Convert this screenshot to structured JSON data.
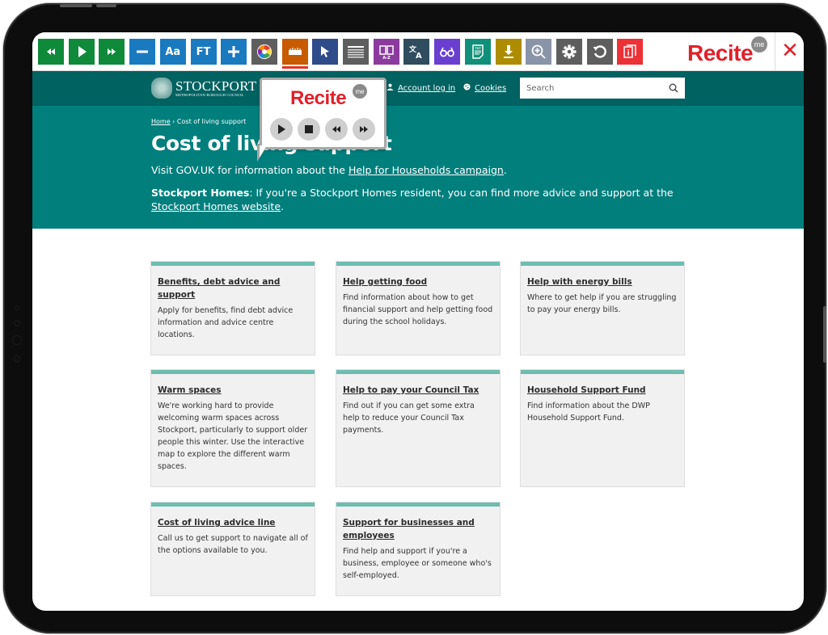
{
  "recite_toolbar": {
    "buttons": [
      {
        "name": "rewind-button",
        "icon": "rewind-icon",
        "label": "",
        "color": "#0f8a3b"
      },
      {
        "name": "play-button",
        "icon": "play-icon",
        "label": "",
        "color": "#0f8a3b"
      },
      {
        "name": "fast-forward-button",
        "icon": "fast-forward-icon",
        "label": "",
        "color": "#0f8a3b"
      },
      {
        "name": "decrease-text-button",
        "icon": "minus-icon",
        "label": "",
        "color": "#1a7ac0"
      },
      {
        "name": "font-button",
        "icon": "font-icon",
        "label": "Aa",
        "color": "#1a7ac0"
      },
      {
        "name": "font-type-button",
        "icon": "font-type-icon",
        "label": "FT",
        "color": "#1a7ac0"
      },
      {
        "name": "increase-text-button",
        "icon": "plus-icon",
        "label": "",
        "color": "#1a7ac0"
      },
      {
        "name": "colour-settings-button",
        "icon": "color-wheel-icon",
        "label": "",
        "color": "#5e5e5e"
      },
      {
        "name": "ruler-button",
        "icon": "ruler-icon",
        "label": "",
        "color": "#c85a00"
      },
      {
        "name": "pointer-button",
        "icon": "cursor-icon",
        "label": "",
        "color": "#2f4b8a"
      },
      {
        "name": "margins-button",
        "icon": "text-lines-icon",
        "label": "",
        "color": "#5e5e5e"
      },
      {
        "name": "dictionary-button",
        "icon": "book-icon",
        "label": "A-Z",
        "color": "#8b3b9e"
      },
      {
        "name": "translate-button",
        "icon": "translate-icon",
        "label": "",
        "color": "#2f4d5e"
      },
      {
        "name": "screen-mask-button",
        "icon": "glasses-icon",
        "label": "",
        "color": "#6a3fd0"
      },
      {
        "name": "text-only-button",
        "icon": "document-icon",
        "label": "TXT",
        "color": "#10907a"
      },
      {
        "name": "download-button",
        "icon": "download-icon",
        "label": "",
        "color": "#ad8c00"
      },
      {
        "name": "magnifier-button",
        "icon": "zoom-in-icon",
        "label": "",
        "color": "#8a94a8"
      },
      {
        "name": "settings-button",
        "icon": "gear-icon",
        "label": "",
        "color": "#5e5e5e"
      },
      {
        "name": "reset-button",
        "icon": "reset-icon",
        "label": "",
        "color": "#5e5e5e"
      },
      {
        "name": "info-button",
        "icon": "info-icon",
        "label": "",
        "color": "#ec3137"
      }
    ],
    "logo": "Recite",
    "logo_badge": "me",
    "close": "✕"
  },
  "popup": {
    "logo": "Recite",
    "logo_badge": "me",
    "controls": [
      "play",
      "stop",
      "rewind",
      "fast-forward"
    ]
  },
  "header": {
    "logo_main": "STOCKPORT",
    "logo_sub": "METROPOLITAN BOROUGH COUNCIL",
    "account_link": "Account log in",
    "cookies_link": "Cookies",
    "search_placeholder": "Search"
  },
  "hero": {
    "breadcrumb_home": "Home",
    "breadcrumb_sep": " › ",
    "breadcrumb_current": "Cost of living support",
    "title": "Cost of living support",
    "p1_text": "Visit GOV.UK for information about the ",
    "p1_link": "Help for Households campaign",
    "p1_end": ".",
    "p2_bold": "Stockport Homes",
    "p2_text": ": If you're a Stockport Homes resident, you can find more advice and support at the ",
    "p2_link": "Stockport Homes website",
    "p2_end": "."
  },
  "cards": [
    {
      "title": "Benefits, debt advice and support",
      "desc": "Apply for benefits, find debt advice information and advice centre locations."
    },
    {
      "title": "Help getting food",
      "desc": "Find information about how to get financial support and help getting food during the school holidays."
    },
    {
      "title": "Help with energy bills",
      "desc": "Where to get help if you are struggling to pay your energy bills."
    },
    {
      "title": "Warm spaces",
      "desc": "We're working hard to provide welcoming warm spaces across Stockport, particularly to support older people this winter. Use the interactive map to explore the different warm spaces."
    },
    {
      "title": "Help to pay your Council Tax",
      "desc": "Find out if you can get some extra help to reduce your Council Tax payments."
    },
    {
      "title": "Household Support Fund",
      "desc": "Find information about the DWP Household Support Fund."
    },
    {
      "title": "Cost of living advice line",
      "desc": "Call us to get support to navigate all of the options available to you."
    },
    {
      "title": "Support for businesses and employees",
      "desc": "Find help and support if you're a business, employee or someone who's self-employed."
    }
  ]
}
